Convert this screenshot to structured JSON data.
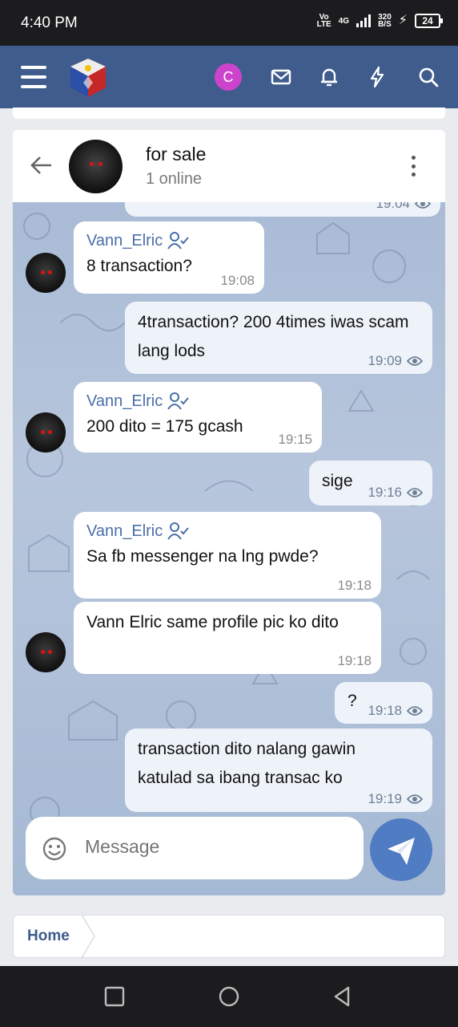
{
  "status_bar": {
    "time": "4:40 PM",
    "volte_top": "Vo",
    "volte_bottom": "LTE",
    "network": "4G",
    "speed_top": "320",
    "speed_bottom": "B/S",
    "battery": "24"
  },
  "header": {
    "user_initial": "C",
    "icons": [
      "menu-icon",
      "mail-icon",
      "bell-icon",
      "bolt-icon",
      "search-icon"
    ]
  },
  "chat": {
    "title": "for sale",
    "subtitle": "1 online"
  },
  "messages": [
    {
      "time": "19:04"
    },
    {
      "sender": "Vann_Elric",
      "text": "8 transaction?",
      "time": "19:08"
    },
    {
      "text": "4transaction? 200 4times iwas scam lang lods",
      "time": "19:09"
    },
    {
      "sender": "Vann_Elric",
      "text": "200 dito = 175 gcash",
      "time": "19:15"
    },
    {
      "text": "sige",
      "time": "19:16"
    },
    {
      "sender": "Vann_Elric",
      "text": "Sa fb messenger na lng pwde?",
      "time": "19:18"
    },
    {
      "text": "Vann Elric same profile pic ko dito",
      "time": "19:18"
    },
    {
      "text": "?",
      "time": "19:18"
    },
    {
      "text": "transaction dito nalang gawin katulad sa ibang transac ko",
      "time": "19:19"
    }
  ],
  "composer": {
    "placeholder": "Message"
  },
  "breadcrumb": {
    "home": "Home"
  },
  "colors": {
    "header": "#3f5c8c",
    "accent": "#4f7cc2",
    "sender": "#4a6ea9"
  }
}
